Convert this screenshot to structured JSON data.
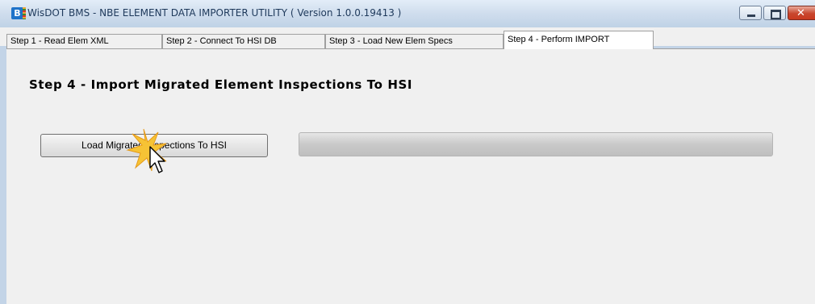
{
  "window": {
    "title": "WisDOT BMS - NBE ELEMENT DATA IMPORTER UTILITY ( Version 1.0.0.19413 )",
    "icon_text": "B"
  },
  "tabs": [
    {
      "label": "Step 1 - Read Elem XML"
    },
    {
      "label": "Step 2 - Connect To HSI DB"
    },
    {
      "label": "Step 3 - Load New Elem Specs"
    },
    {
      "label": "Step 4 - Perform IMPORT"
    }
  ],
  "main": {
    "heading": "Step 4 - Import Migrated Element Inspections To HSI",
    "load_button_label": "Load Migrated Inspections To HSI",
    "progress": 0
  },
  "icons": {
    "minimize": "minimize-icon",
    "maximize": "maximize-icon",
    "close": "close-icon",
    "cursor": "mouse-pointer-icon"
  },
  "colors": {
    "close_button": "#c8462e",
    "titlebar": "#cfdded"
  }
}
